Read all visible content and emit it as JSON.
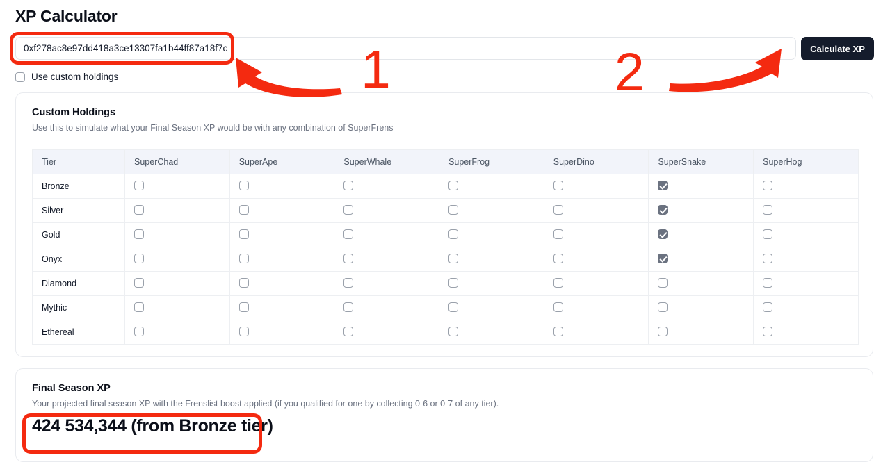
{
  "page": {
    "title": "XP Calculator"
  },
  "address_form": {
    "input_value": "0xf278ac8e97dd418a3ce13307fa1b44ff87a18f7c",
    "input_placeholder": "0x...",
    "calculate_label": "Calculate XP"
  },
  "custom_holdings_toggle": {
    "label": "Use custom holdings",
    "checked": false
  },
  "holdings_card": {
    "title": "Custom Holdings",
    "subtitle": "Use this to simulate what your Final Season XP would be with any combination of SuperFrens",
    "columns": [
      "Tier",
      "SuperChad",
      "SuperApe",
      "SuperWhale",
      "SuperFrog",
      "SuperDino",
      "SuperSnake",
      "SuperHog"
    ],
    "rows": [
      {
        "tier": "Bronze",
        "checks": [
          false,
          false,
          false,
          false,
          false,
          true,
          false
        ]
      },
      {
        "tier": "Silver",
        "checks": [
          false,
          false,
          false,
          false,
          false,
          true,
          false
        ]
      },
      {
        "tier": "Gold",
        "checks": [
          false,
          false,
          false,
          false,
          false,
          true,
          false
        ]
      },
      {
        "tier": "Onyx",
        "checks": [
          false,
          false,
          false,
          false,
          false,
          true,
          false
        ]
      },
      {
        "tier": "Diamond",
        "checks": [
          false,
          false,
          false,
          false,
          false,
          false,
          false
        ]
      },
      {
        "tier": "Mythic",
        "checks": [
          false,
          false,
          false,
          false,
          false,
          false,
          false
        ]
      },
      {
        "tier": "Ethereal",
        "checks": [
          false,
          false,
          false,
          false,
          false,
          false,
          false
        ]
      }
    ]
  },
  "final_card": {
    "title": "Final Season XP",
    "subtitle": "Your projected final season XP with the Frenslist boost applied (if you qualified for one by collecting 0-6 or 0-7 of any tier).",
    "value": "424 534,344 (from Bronze tier)"
  },
  "annotations": {
    "color": "#f42a10",
    "step_one": "1",
    "step_two": "2"
  },
  "colors": {
    "button_bg": "#151c2c",
    "table_header_bg": "#f2f4fa",
    "checked_checkbox": "#6b7280",
    "annotation_red": "#f42a10"
  }
}
